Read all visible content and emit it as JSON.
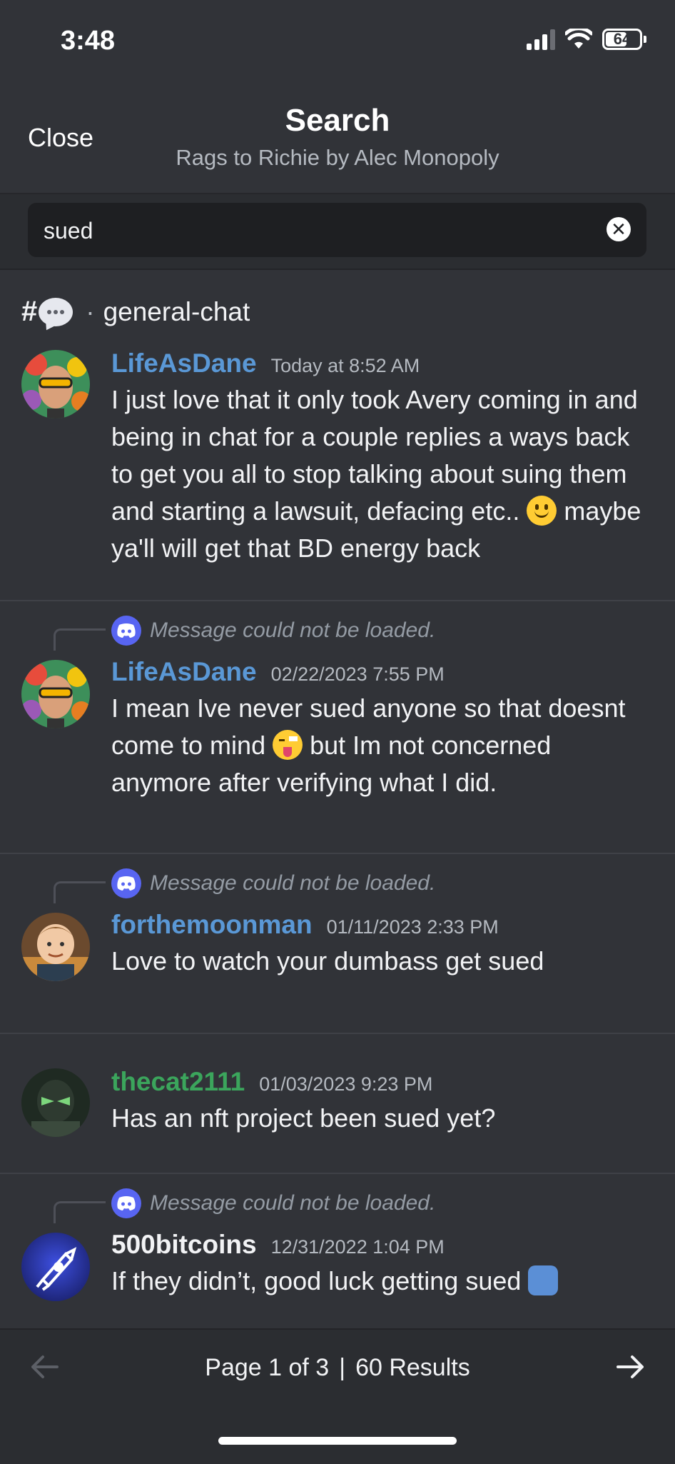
{
  "status_bar": {
    "time": "3:48",
    "battery": "64",
    "battery_level": 0.64
  },
  "header": {
    "close_label": "Close",
    "title": "Search",
    "subtitle": "Rags to Richie by Alec Monopoly"
  },
  "search": {
    "query": "sued"
  },
  "channel": {
    "hash": "#",
    "name": "general-chat"
  },
  "reply_placeholder": "Message could not be loaded.",
  "results": [
    {
      "author": "LifeAsDane",
      "author_color": "#5a98d6",
      "timestamp": "Today at 8:52 AM",
      "text_a": "I just love that it only took Avery coming in and being in chat for a couple replies a ways back to get you all to stop talking about suing them and starting a lawsuit, defacing etc..",
      "text_b": "maybe ya'll will get that BD energy back"
    },
    {
      "author": "LifeAsDane",
      "author_color": "#5a98d6",
      "timestamp": "02/22/2023 7:55 PM",
      "text_a": "I mean Ive never sued anyone so that doesnt come to mind",
      "text_b": "but Im not concerned anymore after verifying what I did."
    },
    {
      "author": "forthemoonman",
      "author_color": "#5a98d6",
      "timestamp": "01/11/2023 2:33 PM",
      "text_a": "Love to watch your dumbass get sued"
    },
    {
      "author": "thecat2111",
      "author_color": "#3ba55c",
      "timestamp": "01/03/2023 9:23 PM",
      "text_a": "Has an nft project been sued yet?"
    },
    {
      "author": "500bitcoins",
      "author_color": "#f2f3f5",
      "timestamp": "12/31/2022 1:04 PM",
      "text_a": "If they didn’t, good luck getting sued"
    }
  ],
  "pagination": {
    "page_text": "Page 1 of 3",
    "separator": "|",
    "results_text": "60 Results"
  }
}
